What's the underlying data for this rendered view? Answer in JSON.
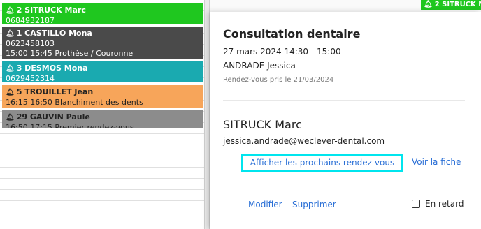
{
  "appointments": [
    {
      "name": "2 SITRUCK Marc",
      "line1": "0684932187",
      "line2": ""
    },
    {
      "name": "1 CASTILLO Mona",
      "line1": "0623458103",
      "line2": "15:00 15:45 Prothèse / Couronne"
    },
    {
      "name": "3 DESMOS Mona",
      "line1": "0629452314",
      "line2": ""
    },
    {
      "name": "5 TROUILLET Jean",
      "line1": "16:15 16:50 Blanchiment des dents",
      "line2": ""
    },
    {
      "name": "29 GAUVIN Paule",
      "line1": "16:50 17:15 Premier rendez-vous",
      "line2": ""
    }
  ],
  "right_column": {
    "appt_name": "2 SITRUCK M"
  },
  "popover": {
    "title": "Consultation dentaire",
    "datetime": "27 mars 2024 14:30 - 15:00",
    "practitioner": "ANDRADE Jessica",
    "taken_on": "Rendez-vous pris le 21/03/2024",
    "patient_name": "SITRUCK Marc",
    "patient_email": "jessica.andrade@weclever-dental.com",
    "next_appointments_link": "Afficher les prochains rendez-vous",
    "view_record_link": "Voir la fiche",
    "modify_link": "Modifier",
    "delete_link": "Supprimer",
    "late_label": "En retard",
    "late_checked": false
  },
  "colors": {
    "green": "#1fc71f",
    "dark": "#4a4a4a",
    "teal": "#1aaab0",
    "orange": "#f7a55a",
    "grey": "#8c8c8c",
    "link": "#2a6fd6",
    "highlight": "#00e5ee"
  }
}
